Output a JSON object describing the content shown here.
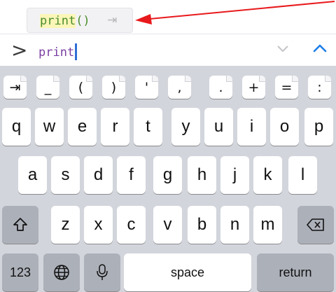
{
  "autocomplete": {
    "suggestion": "print()",
    "typed_part": "print",
    "rest_part": "()",
    "tab_symbol": "⇥"
  },
  "console": {
    "prompt": ">",
    "input_value": "print"
  },
  "colors": {
    "annotation_arrow": "#e8191c",
    "caret": "#2f6fd6",
    "keyword_text": "#7b3fa3",
    "suggestion_text": "#4a8c2a"
  },
  "keyboard": {
    "symbols_row": [
      "⇥",
      "_",
      "(",
      ")",
      "'",
      ",",
      ".",
      "+",
      "=",
      ":"
    ],
    "row1": [
      "q",
      "w",
      "e",
      "r",
      "t",
      "y",
      "u",
      "i",
      "o",
      "p"
    ],
    "row2": [
      "a",
      "s",
      "d",
      "f",
      "g",
      "h",
      "j",
      "k",
      "l"
    ],
    "row3": [
      "z",
      "x",
      "c",
      "v",
      "b",
      "n",
      "m"
    ],
    "numbers_label": "123",
    "space_label": "space",
    "return_label": "return"
  }
}
